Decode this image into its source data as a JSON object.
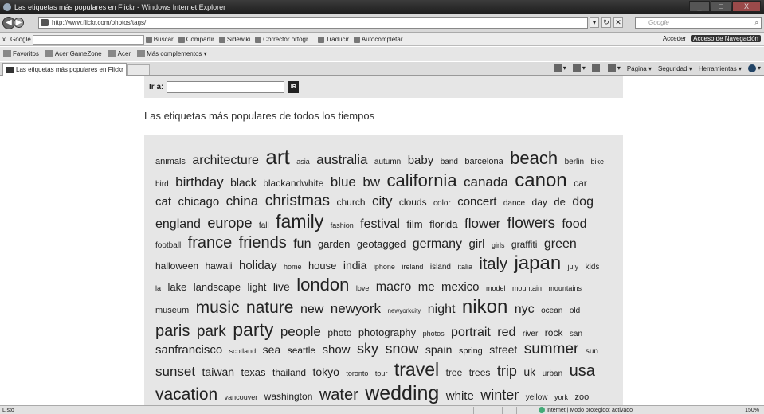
{
  "window": {
    "title": "Las etiquetas más populares en Flickr - Windows Internet Explorer",
    "minimize": "_",
    "maximize": "□",
    "close": "X"
  },
  "address": {
    "url": "http://www.flickr.com/photos/tags/",
    "search_placeholder": "Google",
    "search_icon": "search-icon"
  },
  "google_toolbar": {
    "label": "Google",
    "items": [
      "Buscar",
      "Compartir",
      "Sidewiki",
      "Corrector ortogr...",
      "Traducir",
      "Autocompletar"
    ],
    "acceder": "Acceder",
    "badge": "Acceso de Navegación"
  },
  "favorites": {
    "items": [
      "Favoritos",
      "Acer GameZone",
      "Acer",
      "Más complementos ▾"
    ]
  },
  "tab": {
    "label": "Las etiquetas más populares en Flickr"
  },
  "commands": [
    "Página ▾",
    "Seguridad ▾",
    "Herramientas ▾"
  ],
  "page": {
    "goto_label": "Ir a:",
    "goto_button": "IR",
    "heading": "Las etiquetas más populares de todos los tiempos"
  },
  "tags": [
    {
      "t": "animals",
      "s": 11
    },
    {
      "t": "architecture",
      "s": 16
    },
    {
      "t": "art",
      "s": 26
    },
    {
      "t": "asia",
      "s": 9
    },
    {
      "t": "australia",
      "s": 17
    },
    {
      "t": "autumn",
      "s": 10
    },
    {
      "t": "baby",
      "s": 15
    },
    {
      "t": "band",
      "s": 10
    },
    {
      "t": "barcelona",
      "s": 11
    },
    {
      "t": "beach",
      "s": 22
    },
    {
      "t": "berlin",
      "s": 10
    },
    {
      "t": "bike",
      "s": 9
    },
    {
      "t": "bird",
      "s": 10
    },
    {
      "t": "birthday",
      "s": 17
    },
    {
      "t": "black",
      "s": 14
    },
    {
      "t": "blackandwhite",
      "s": 12
    },
    {
      "t": "blue",
      "s": 17
    },
    {
      "t": "bw",
      "s": 17
    },
    {
      "t": "california",
      "s": 22
    },
    {
      "t": "canada",
      "s": 17
    },
    {
      "t": "canon",
      "s": 24
    },
    {
      "t": "car",
      "s": 12
    },
    {
      "t": "cat",
      "s": 15
    },
    {
      "t": "chicago",
      "s": 15
    },
    {
      "t": "china",
      "s": 17
    },
    {
      "t": "christmas",
      "s": 19
    },
    {
      "t": "church",
      "s": 12
    },
    {
      "t": "city",
      "s": 17
    },
    {
      "t": "clouds",
      "s": 12
    },
    {
      "t": "color",
      "s": 10
    },
    {
      "t": "concert",
      "s": 15
    },
    {
      "t": "dance",
      "s": 10
    },
    {
      "t": "day",
      "s": 12
    },
    {
      "t": "de",
      "s": 13
    },
    {
      "t": "dog",
      "s": 16
    },
    {
      "t": "england",
      "s": 16
    },
    {
      "t": "europe",
      "s": 18
    },
    {
      "t": "fall",
      "s": 10
    },
    {
      "t": "family",
      "s": 23
    },
    {
      "t": "fashion",
      "s": 9
    },
    {
      "t": "festival",
      "s": 16
    },
    {
      "t": "film",
      "s": 13
    },
    {
      "t": "florida",
      "s": 13
    },
    {
      "t": "flower",
      "s": 17
    },
    {
      "t": "flowers",
      "s": 19
    },
    {
      "t": "food",
      "s": 16
    },
    {
      "t": "football",
      "s": 10
    },
    {
      "t": "france",
      "s": 20
    },
    {
      "t": "friends",
      "s": 20
    },
    {
      "t": "fun",
      "s": 16
    },
    {
      "t": "garden",
      "s": 13
    },
    {
      "t": "geotagged",
      "s": 13
    },
    {
      "t": "germany",
      "s": 16
    },
    {
      "t": "girl",
      "s": 15
    },
    {
      "t": "girls",
      "s": 9
    },
    {
      "t": "graffiti",
      "s": 12
    },
    {
      "t": "green",
      "s": 16
    },
    {
      "t": "halloween",
      "s": 12
    },
    {
      "t": "hawaii",
      "s": 12
    },
    {
      "t": "holiday",
      "s": 15
    },
    {
      "t": "home",
      "s": 9
    },
    {
      "t": "house",
      "s": 13
    },
    {
      "t": "india",
      "s": 14
    },
    {
      "t": "iphone",
      "s": 9
    },
    {
      "t": "ireland",
      "s": 9
    },
    {
      "t": "island",
      "s": 10
    },
    {
      "t": "italia",
      "s": 9
    },
    {
      "t": "italy",
      "s": 20
    },
    {
      "t": "japan",
      "s": 24
    },
    {
      "t": "july",
      "s": 9
    },
    {
      "t": "kids",
      "s": 10
    },
    {
      "t": "la",
      "s": 9
    },
    {
      "t": "lake",
      "s": 13
    },
    {
      "t": "landscape",
      "s": 13
    },
    {
      "t": "light",
      "s": 13
    },
    {
      "t": "live",
      "s": 14
    },
    {
      "t": "london",
      "s": 22
    },
    {
      "t": "love",
      "s": 9
    },
    {
      "t": "macro",
      "s": 16
    },
    {
      "t": "me",
      "s": 15
    },
    {
      "t": "mexico",
      "s": 15
    },
    {
      "t": "model",
      "s": 9
    },
    {
      "t": "mountain",
      "s": 9
    },
    {
      "t": "mountains",
      "s": 9
    },
    {
      "t": "museum",
      "s": 11
    },
    {
      "t": "music",
      "s": 21
    },
    {
      "t": "nature",
      "s": 21
    },
    {
      "t": "new",
      "s": 16
    },
    {
      "t": "newyork",
      "s": 17
    },
    {
      "t": "newyorkcity",
      "s": 8
    },
    {
      "t": "night",
      "s": 16
    },
    {
      "t": "nikon",
      "s": 24
    },
    {
      "t": "nyc",
      "s": 16
    },
    {
      "t": "ocean",
      "s": 10
    },
    {
      "t": "old",
      "s": 10
    },
    {
      "t": "paris",
      "s": 20
    },
    {
      "t": "park",
      "s": 19
    },
    {
      "t": "party",
      "s": 23
    },
    {
      "t": "people",
      "s": 17
    },
    {
      "t": "photo",
      "s": 12
    },
    {
      "t": "photography",
      "s": 13
    },
    {
      "t": "photos",
      "s": 9
    },
    {
      "t": "portrait",
      "s": 16
    },
    {
      "t": "red",
      "s": 16
    },
    {
      "t": "river",
      "s": 10
    },
    {
      "t": "rock",
      "s": 12
    },
    {
      "t": "san",
      "s": 10
    },
    {
      "t": "sanfrancisco",
      "s": 15
    },
    {
      "t": "scotland",
      "s": 9
    },
    {
      "t": "sea",
      "s": 14
    },
    {
      "t": "seattle",
      "s": 12
    },
    {
      "t": "show",
      "s": 15
    },
    {
      "t": "sky",
      "s": 18
    },
    {
      "t": "snow",
      "s": 18
    },
    {
      "t": "spain",
      "s": 14
    },
    {
      "t": "spring",
      "s": 11
    },
    {
      "t": "street",
      "s": 14
    },
    {
      "t": "summer",
      "s": 19
    },
    {
      "t": "sun",
      "s": 10
    },
    {
      "t": "sunset",
      "s": 17
    },
    {
      "t": "taiwan",
      "s": 14
    },
    {
      "t": "texas",
      "s": 13
    },
    {
      "t": "thailand",
      "s": 12
    },
    {
      "t": "tokyo",
      "s": 14
    },
    {
      "t": "toronto",
      "s": 9
    },
    {
      "t": "tour",
      "s": 9
    },
    {
      "t": "travel",
      "s": 23
    },
    {
      "t": "tree",
      "s": 12
    },
    {
      "t": "trees",
      "s": 12
    },
    {
      "t": "trip",
      "s": 18
    },
    {
      "t": "uk",
      "s": 14
    },
    {
      "t": "urban",
      "s": 10
    },
    {
      "t": "usa",
      "s": 20
    },
    {
      "t": "vacation",
      "s": 21
    },
    {
      "t": "vancouver",
      "s": 9
    },
    {
      "t": "washington",
      "s": 12
    },
    {
      "t": "water",
      "s": 20
    },
    {
      "t": "wedding",
      "s": 25
    },
    {
      "t": "white",
      "s": 15
    },
    {
      "t": "winter",
      "s": 18
    },
    {
      "t": "yellow",
      "s": 10
    },
    {
      "t": "york",
      "s": 9
    },
    {
      "t": "zoo",
      "s": 11
    }
  ],
  "status": {
    "left": "Listo",
    "zone": "Internet | Modo protegido: activado",
    "zoom": "150%"
  }
}
